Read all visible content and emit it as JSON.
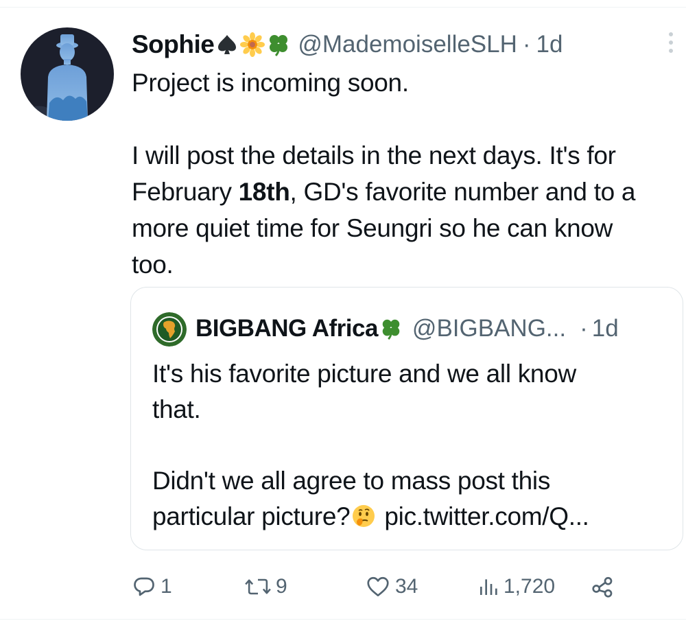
{
  "tweet": {
    "author": {
      "display_name": "Sophie",
      "handle": "@MademoiselleSLH",
      "badges": [
        "spade-icon",
        "sunflower-icon",
        "clover-icon"
      ]
    },
    "separator": "·",
    "time": "1d",
    "lines": {
      "line1": "Project is incoming soon.",
      "line2": "I will post the details in the next days. It's for",
      "line3_pre": "February ",
      "line3_bold": "18th",
      "line3_post": ", GD's favorite number and to a",
      "line4": "more quiet time for Seungri so he can know",
      "line5": "too."
    }
  },
  "quoted": {
    "display_name": "BIGBANG Africa",
    "badges": [
      "clover-icon"
    ],
    "handle": "@BIGBANG...",
    "separator": "·",
    "time": "1d",
    "lines": {
      "line1": "It's his favorite picture and we all know",
      "line2": "that.",
      "line3": "Didn't we all agree to mass post this",
      "line4_pre": "particular picture?",
      "line4_emoji": "thinking-face-icon",
      "line4_post": " pic.twitter.com/Q..."
    }
  },
  "actions": {
    "replies": "1",
    "retweets": "9",
    "likes": "34",
    "views": "1,720"
  },
  "colors": {
    "text": "#0f1419",
    "secondary": "#536471",
    "border": "#dfe5e8"
  }
}
